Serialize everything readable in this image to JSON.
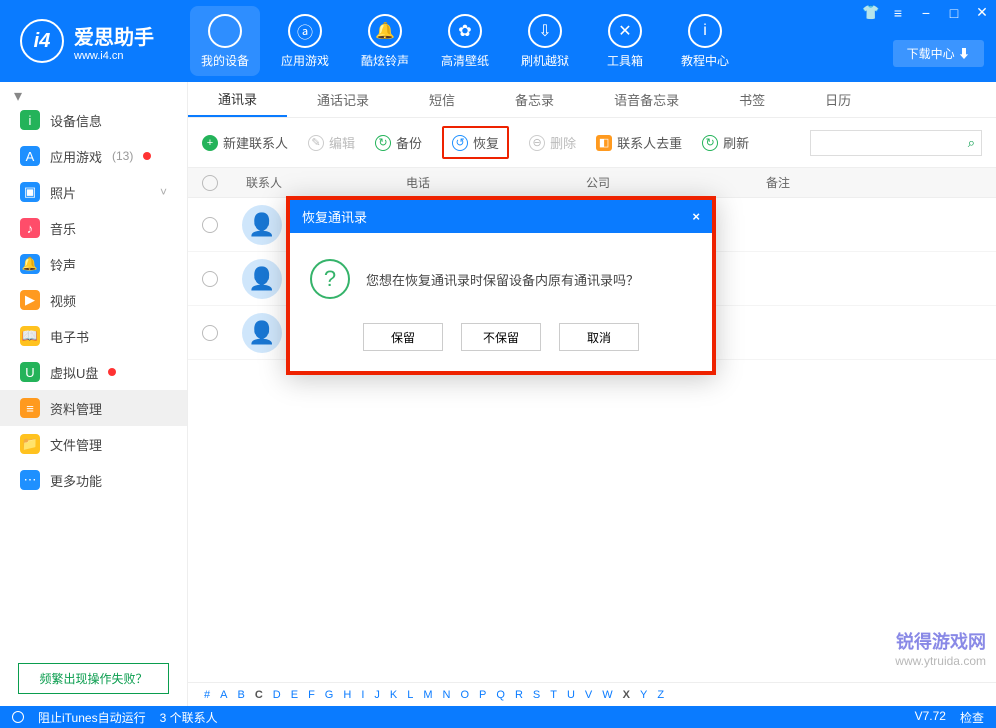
{
  "app": {
    "name": "爱思助手",
    "url": "www.i4.cn",
    "logo_letter": "i4"
  },
  "window": {
    "download_btn": "下载中心 ⬇"
  },
  "nav": [
    {
      "label": "我的设备",
      "glyph": ""
    },
    {
      "label": "应用游戏",
      "glyph": "ⓐ"
    },
    {
      "label": "酷炫铃声",
      "glyph": "🔔"
    },
    {
      "label": "高清壁纸",
      "glyph": "✿"
    },
    {
      "label": "刷机越狱",
      "glyph": "⇩"
    },
    {
      "label": "工具箱",
      "glyph": "✕"
    },
    {
      "label": "教程中心",
      "glyph": "i"
    }
  ],
  "sidebar": {
    "items": [
      {
        "label": "设备信息",
        "color": "#24b35a",
        "glyph": "i"
      },
      {
        "label": "应用游戏",
        "color": "#1e90ff",
        "glyph": "A",
        "count": "(13)",
        "dot": true
      },
      {
        "label": "照片",
        "color": "#1e90ff",
        "glyph": "▣",
        "chev": true
      },
      {
        "label": "音乐",
        "color": "#ff4d6a",
        "glyph": "♪"
      },
      {
        "label": "铃声",
        "color": "#1e90ff",
        "glyph": "🔔"
      },
      {
        "label": "视频",
        "color": "#ff9a1f",
        "glyph": "▶"
      },
      {
        "label": "电子书",
        "color": "#ffc21f",
        "glyph": "📖"
      },
      {
        "label": "虚拟U盘",
        "color": "#24b35a",
        "glyph": "U",
        "dot": true
      },
      {
        "label": "资料管理",
        "color": "#ff9a1f",
        "glyph": "≡",
        "selected": true
      },
      {
        "label": "文件管理",
        "color": "#ffc21f",
        "glyph": "📁"
      },
      {
        "label": "更多功能",
        "color": "#1e90ff",
        "glyph": "⋯"
      }
    ],
    "fail_btn": "频繁出现操作失败？"
  },
  "tabs": [
    "通讯录",
    "通话记录",
    "短信",
    "备忘录",
    "语音备忘录",
    "书签",
    "日历"
  ],
  "toolbar": {
    "new_contact": "新建联系人",
    "edit": "编辑",
    "backup": "备份",
    "restore": "恢复",
    "delete": "删除",
    "dedupe": "联系人去重",
    "refresh": "刷新"
  },
  "table": {
    "headers": {
      "contact": "联系人",
      "phone": "电话",
      "company": "公司",
      "note": "备注"
    }
  },
  "dialog": {
    "title": "恢复通讯录",
    "message": "您想在恢复通讯录时保留设备内原有通讯录吗？",
    "keep": "保留",
    "discard": "不保留",
    "cancel": "取消"
  },
  "alpha": [
    "#",
    "A",
    "B",
    "C",
    "D",
    "E",
    "F",
    "G",
    "H",
    "I",
    "J",
    "K",
    "L",
    "M",
    "N",
    "O",
    "P",
    "Q",
    "R",
    "S",
    "T",
    "U",
    "V",
    "W",
    "X",
    "Y",
    "Z"
  ],
  "alpha_bold": [
    "C",
    "X"
  ],
  "status": {
    "itunes": "阻止iTunes自动运行",
    "count": "3 个联系人",
    "version": "V7.72",
    "update": "检查"
  },
  "watermark": {
    "brand": "锐得游戏网",
    "url": "www.ytruida.com"
  }
}
